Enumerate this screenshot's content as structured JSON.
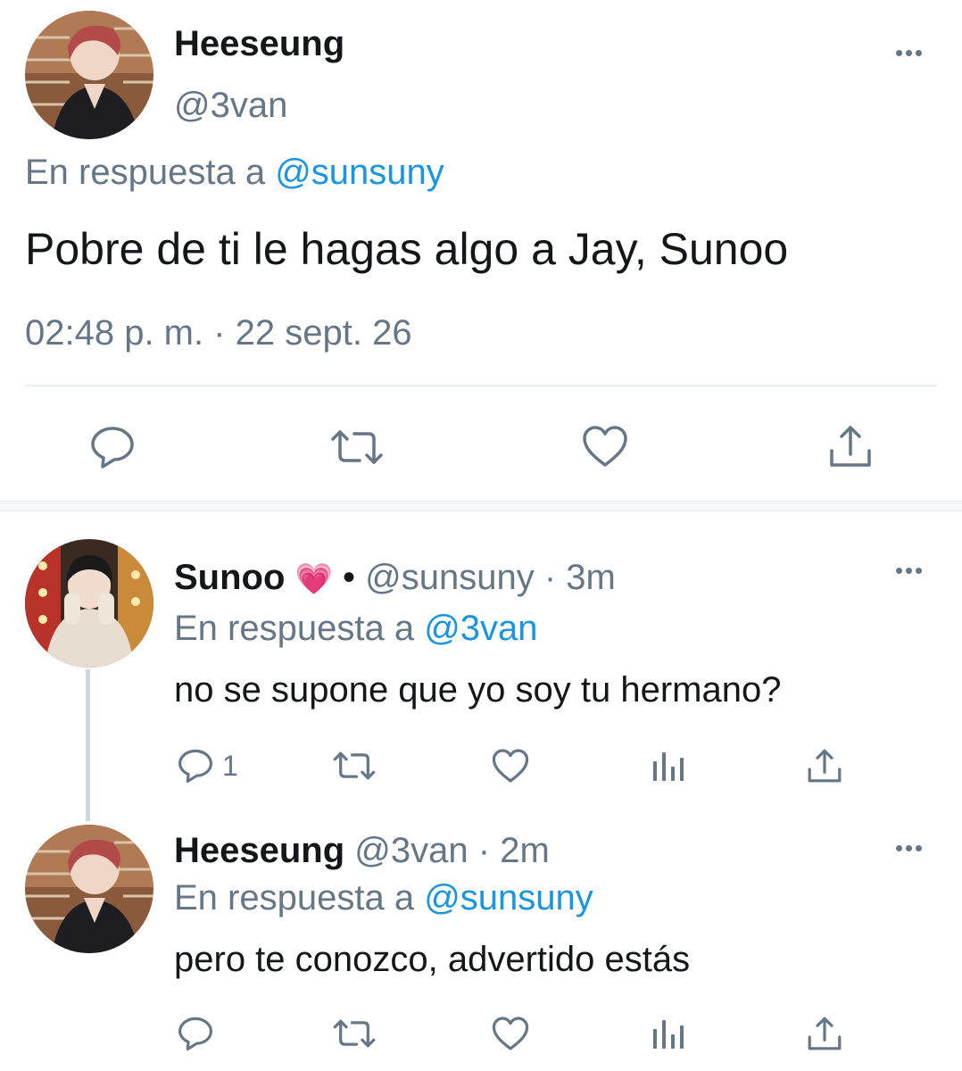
{
  "main_tweet": {
    "display_name": "Heeseung",
    "handle": "@3van",
    "reply_prefix": "En respuesta a",
    "reply_to": "@sunsuny",
    "text": "Pobre de ti le hagas algo a Jay, Sunoo",
    "timestamp": "02:48 p. m. · 22 sept. 26",
    "actions": [
      "reply-icon",
      "retweet-icon",
      "like-icon",
      "share-icon"
    ]
  },
  "replies": [
    {
      "display_name": "Sunoo",
      "emoji": "💗",
      "bullet": "•",
      "handle": "@sunsuny",
      "time": "· 3m",
      "reply_prefix": "En respuesta a",
      "reply_to": "@3van",
      "text": "no se supone que yo soy tu hermano?",
      "reply_count": "1",
      "actions": [
        "reply-icon",
        "retweet-icon",
        "like-icon",
        "analytics-icon",
        "share-icon"
      ]
    },
    {
      "display_name": "Heeseung",
      "handle": "@3van",
      "time": "· 2m",
      "reply_prefix": "En respuesta a",
      "reply_to": "@sunsuny",
      "text": "pero te conozco, advertido estás",
      "actions": [
        "reply-icon",
        "retweet-icon",
        "like-icon",
        "analytics-icon",
        "share-icon"
      ]
    }
  ],
  "colors": {
    "accent": "#1b95e0",
    "secondary_text": "#657786",
    "primary_text": "#14171a",
    "divider": "#e6ecf0"
  }
}
